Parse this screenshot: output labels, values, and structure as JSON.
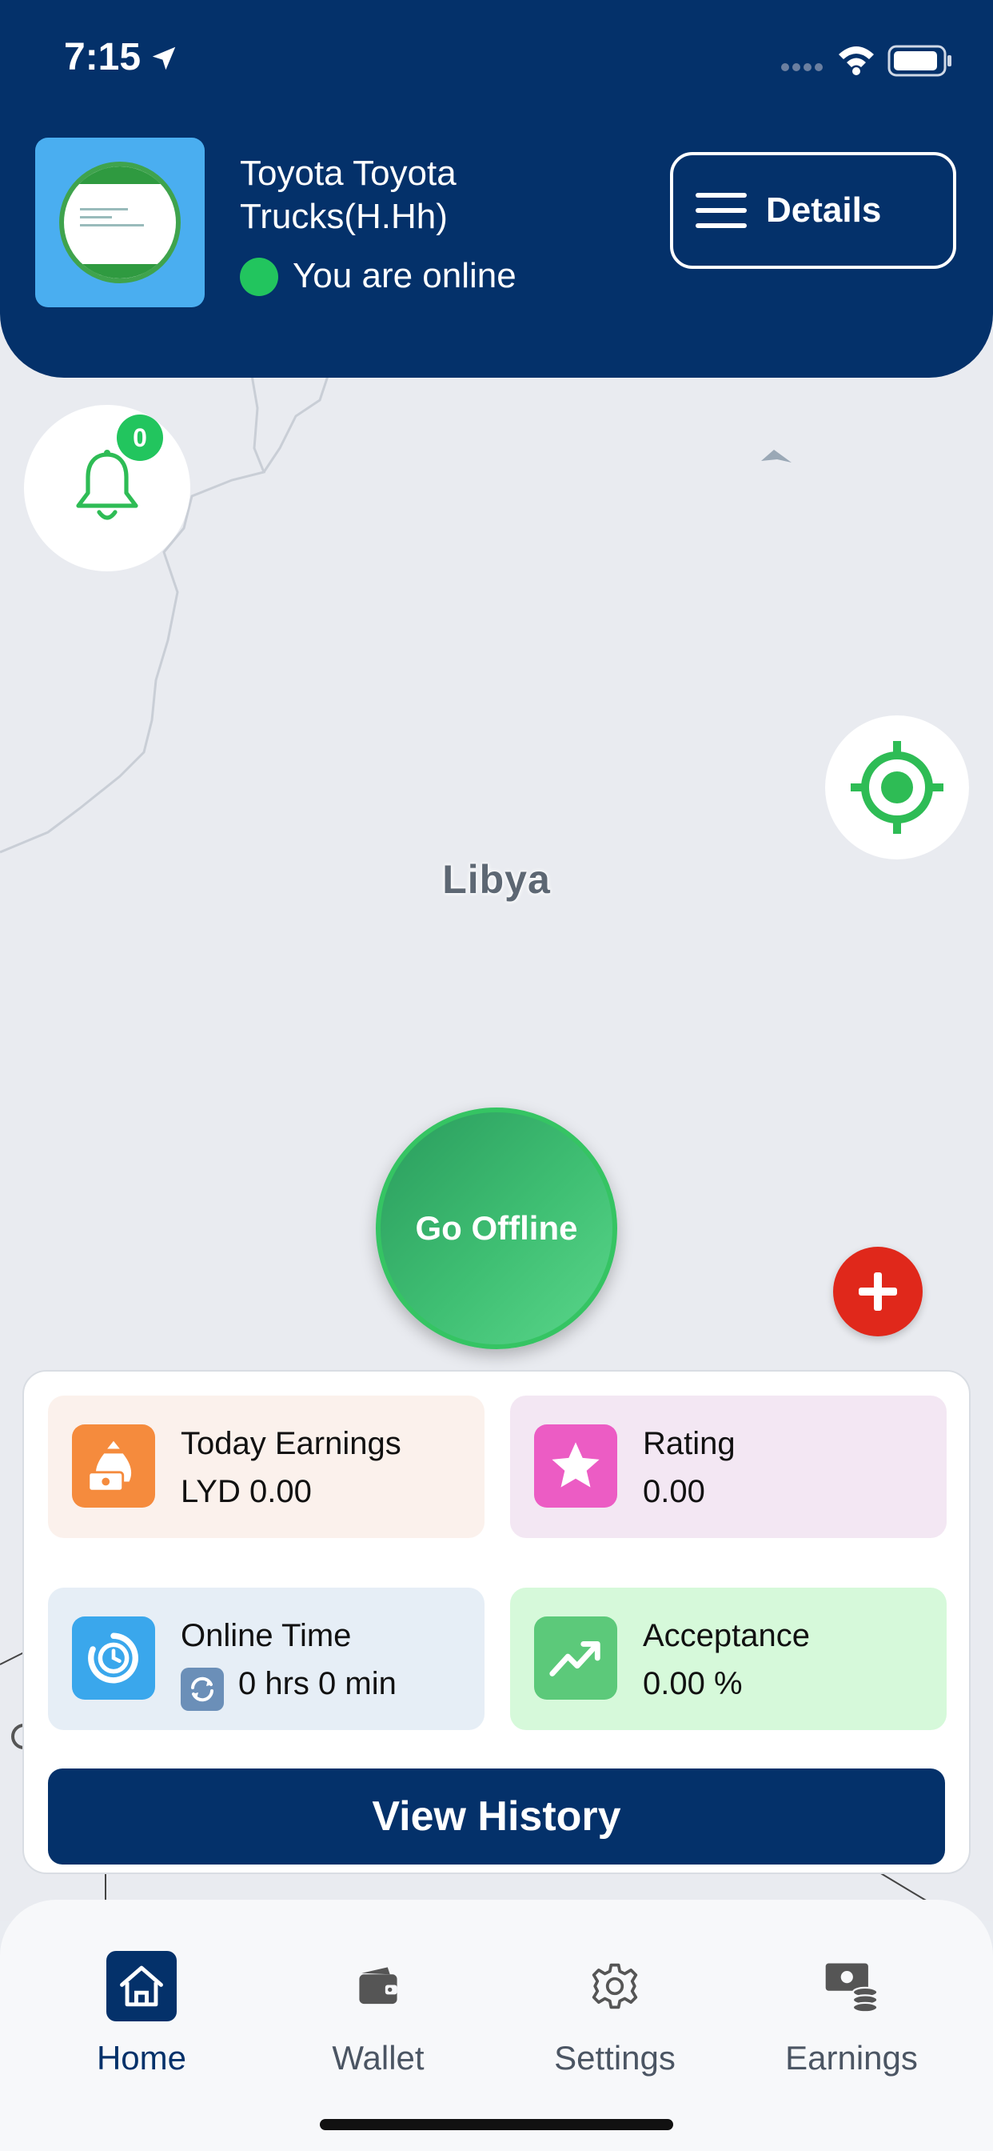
{
  "status_bar": {
    "time": "7:15"
  },
  "header": {
    "driver_name": "Toyota Toyota Trucks(H.Hh)",
    "online_status": "You are online",
    "details_label": "Details"
  },
  "map": {
    "country_label": "Libya"
  },
  "notifications": {
    "count": "0"
  },
  "go_offline_label": "Go Offline",
  "stats": {
    "today_earnings": {
      "title": "Today Earnings",
      "value": "LYD 0.00"
    },
    "rating": {
      "title": "Rating",
      "value": "0.00"
    },
    "online_time": {
      "title": "Online Time",
      "value": "0 hrs 0 min"
    },
    "acceptance": {
      "title": "Acceptance",
      "value": "0.00 %"
    }
  },
  "view_history_label": "View History",
  "bottom_nav": {
    "items": [
      {
        "label": "Home",
        "icon": "home-icon",
        "active": true
      },
      {
        "label": "Wallet",
        "icon": "wallet-icon",
        "active": false
      },
      {
        "label": "Settings",
        "icon": "gear-icon",
        "active": false
      },
      {
        "label": "Earnings",
        "icon": "earnings-icon",
        "active": false
      }
    ]
  },
  "colors": {
    "brand_navy": "#04316a",
    "online_green": "#22c55e",
    "sos_red": "#e0281b"
  }
}
